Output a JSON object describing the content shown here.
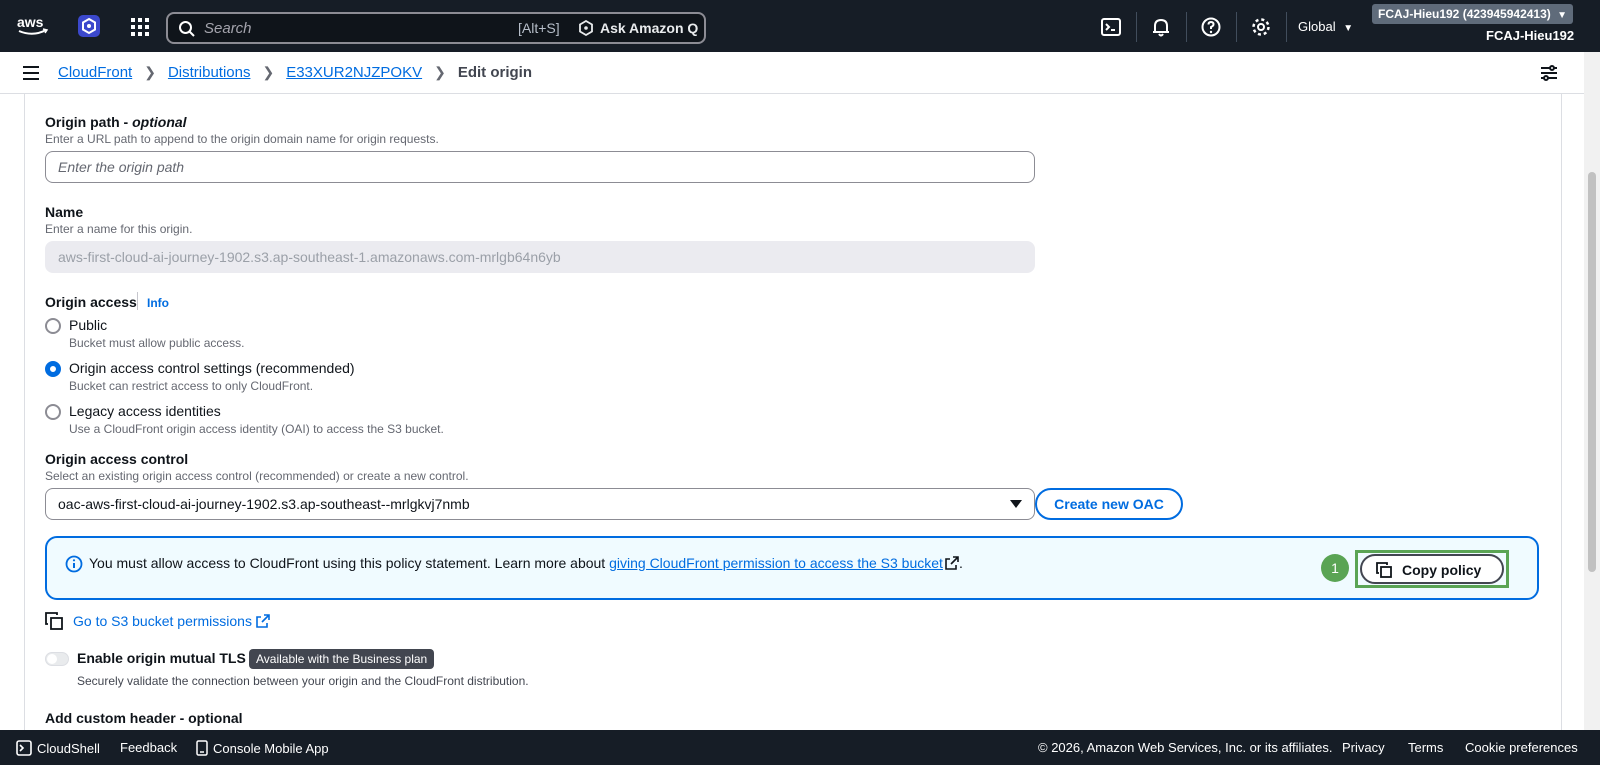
{
  "topnav": {
    "search_placeholder": "Search",
    "search_shortcut": "[Alt+S]",
    "ask_q": "Ask Amazon Q",
    "region": "Global",
    "account_pill": "FCAJ-Hieu192 (423945942413)",
    "account_user": "FCAJ-Hieu192"
  },
  "breadcrumb": {
    "items": [
      "CloudFront",
      "Distributions",
      "E33XUR2NJZPOKV"
    ],
    "current": "Edit origin"
  },
  "form": {
    "origin_path": {
      "label": "Origin path - ",
      "label_optional": "optional",
      "description": "Enter a URL path to append to the origin domain name for origin requests.",
      "placeholder": "Enter the origin path"
    },
    "name": {
      "label": "Name",
      "description": "Enter a name for this origin.",
      "value": "aws-first-cloud-ai-journey-1902.s3.ap-southeast-1.amazonaws.com-mrlgb64n6yb"
    },
    "origin_access": {
      "label": "Origin access",
      "info": "Info",
      "options": [
        {
          "label": "Public",
          "description": "Bucket must allow public access."
        },
        {
          "label": "Origin access control settings (recommended)",
          "description": "Bucket can restrict access to only CloudFront."
        },
        {
          "label": "Legacy access identities",
          "description": "Use a CloudFront origin access identity (OAI) to access the S3 bucket."
        }
      ],
      "selected": "Origin access control settings (recommended)"
    },
    "origin_access_control": {
      "label": "Origin access control",
      "description": "Select an existing origin access control (recommended) or create a new control.",
      "value": "oac-aws-first-cloud-ai-journey-1902.s3.ap-southeast--mrlgkvj7nmb",
      "create_button": "Create new OAC"
    },
    "alert": {
      "text_before": "You must allow access to CloudFront using this policy statement. Learn more about ",
      "link": "giving CloudFront permission to access the S3 bucket",
      "text_after": ".",
      "step": "1",
      "copy_button": "Copy policy"
    },
    "s3_link": "Go to S3 bucket permissions",
    "mtls": {
      "label": "Enable origin mutual TLS",
      "badge": "Available with the Business plan",
      "description": "Securely validate the connection between your origin and the CloudFront distribution."
    },
    "next_section_cut": "Add custom header - optional"
  },
  "footer": {
    "cloudshell": "CloudShell",
    "feedback": "Feedback",
    "mobile": "Console Mobile App",
    "copyright": "© 2026, Amazon Web Services, Inc. or its affiliates.",
    "privacy": "Privacy",
    "terms": "Terms",
    "cookies": "Cookie preferences"
  },
  "colors": {
    "nav_bg": "#161d26",
    "link": "#006ce0",
    "alert_bg": "#f0fbff",
    "highlight": "#5aa454"
  }
}
